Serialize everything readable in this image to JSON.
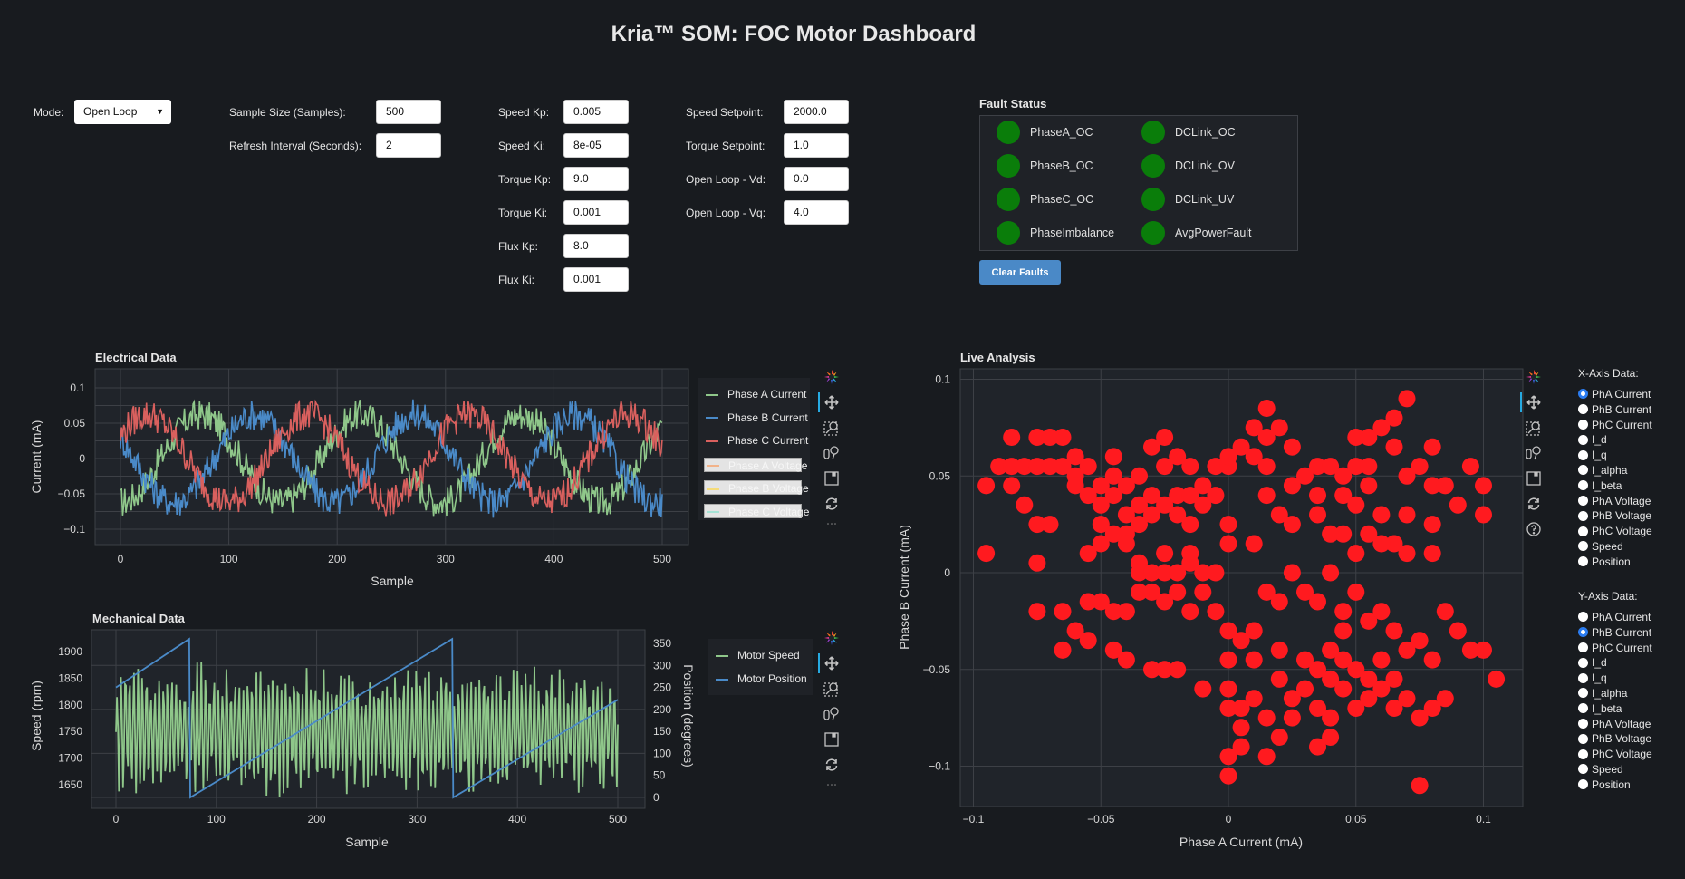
{
  "header": {
    "title": "Kria™ SOM: FOC Motor Dashboard"
  },
  "controls": {
    "mode": {
      "label": "Mode:",
      "value": "Open Loop"
    },
    "sample_size": {
      "label": "Sample Size (Samples):",
      "value": "500"
    },
    "refresh_interval": {
      "label": "Refresh Interval (Seconds):",
      "value": "2"
    },
    "gains": [
      {
        "label": "Speed Kp:",
        "value": "0.005"
      },
      {
        "label": "Speed Ki:",
        "value": "8e-05"
      },
      {
        "label": "Torque Kp:",
        "value": "9.0"
      },
      {
        "label": "Torque Ki:",
        "value": "0.001"
      },
      {
        "label": "Flux Kp:",
        "value": "8.0"
      },
      {
        "label": "Flux Ki:",
        "value": "0.001"
      }
    ],
    "setpoints": [
      {
        "label": "Speed Setpoint:",
        "value": "2000.0"
      },
      {
        "label": "Torque Setpoint:",
        "value": "1.0"
      },
      {
        "label": "Open Loop - Vd:",
        "value": "0.0"
      },
      {
        "label": "Open Loop - Vq:",
        "value": "4.0"
      }
    ]
  },
  "faults": {
    "title": "Fault Status",
    "ok_color": "#0a7d0a",
    "items": [
      {
        "name": "PhaseA_OC",
        "status": "ok"
      },
      {
        "name": "PhaseB_OC",
        "status": "ok"
      },
      {
        "name": "PhaseC_OC",
        "status": "ok"
      },
      {
        "name": "PhaseImbalance",
        "status": "ok"
      },
      {
        "name": "DCLink_OC",
        "status": "ok"
      },
      {
        "name": "DCLink_OV",
        "status": "ok"
      },
      {
        "name": "DCLink_UV",
        "status": "ok"
      },
      {
        "name": "AvgPowerFault",
        "status": "ok"
      }
    ],
    "clear_label": "Clear Faults"
  },
  "toolbar_icons": [
    "bokeh-logo-icon",
    "pan-icon",
    "box-zoom-icon",
    "wheel-zoom-icon",
    "save-icon",
    "reset-icon",
    "more-icon"
  ],
  "analysis_controls": {
    "x_title": "X-Axis Data:",
    "y_title": "Y-Axis Data:",
    "options": [
      "PhA Current",
      "PhB Current",
      "PhC Current",
      "I_d",
      "I_q",
      "I_alpha",
      "I_beta",
      "PhA Voltage",
      "PhB Voltage",
      "PhC Voltage",
      "Speed",
      "Position"
    ],
    "x_selected": "PhA Current",
    "y_selected": "PhB Current"
  },
  "chart_data": [
    {
      "id": "electrical",
      "type": "line",
      "title": "Electrical Data",
      "xlabel": "Sample",
      "ylabel": "Current (mA)",
      "xlim": [
        -22,
        528
      ],
      "ylim": [
        -0.12,
        0.125
      ],
      "xticks": [
        0,
        100,
        200,
        300,
        400,
        500
      ],
      "yticks": [
        0.1,
        0.05,
        0,
        -0.05,
        -0.1
      ],
      "ytick_labels": [
        "0.1",
        "0.05",
        "0",
        "−0.05",
        "−0.1"
      ],
      "grid": true,
      "legend": "right",
      "noise": 0.022,
      "series": [
        {
          "name": "Phase A Current",
          "color": "#8fc78a",
          "amplitude": 0.062,
          "period": 148,
          "phase_deg": -90,
          "visible": true
        },
        {
          "name": "Phase B Current",
          "color": "#4a8ac8",
          "amplitude": 0.062,
          "period": 148,
          "phase_deg": 150,
          "visible": true
        },
        {
          "name": "Phase C Current",
          "color": "#d9605e",
          "amplitude": 0.062,
          "period": 148,
          "phase_deg": 30,
          "visible": true
        },
        {
          "name": "Phase A Voltage",
          "color": "#f2b38a",
          "visible": false
        },
        {
          "name": "Phase B Voltage",
          "color": "#f5dc7a",
          "visible": false
        },
        {
          "name": "Phase C Voltage",
          "color": "#a6e3d6",
          "visible": false
        }
      ],
      "n_samples": 500
    },
    {
      "id": "mechanical",
      "type": "line",
      "title": "Mechanical Data",
      "xlabel": "Sample",
      "ylabel": "Speed (rpm)",
      "ylabel_right": "Position (degrees)",
      "xlim": [
        -25,
        530
      ],
      "ylim": [
        1620,
        1935
      ],
      "ylim_right": [
        -10,
        375
      ],
      "xticks": [
        0,
        100,
        200,
        300,
        400,
        500
      ],
      "yticks": [
        1650,
        1700,
        1750,
        1800,
        1850,
        1900
      ],
      "yticks_right": [
        0,
        50,
        100,
        150,
        200,
        250,
        300,
        350
      ],
      "grid": true,
      "legend": "right",
      "series": [
        {
          "name": "Motor Speed",
          "color": "#8fc78a",
          "axis": "left",
          "mean": 1750,
          "oscillation": 110,
          "period": 4.2
        },
        {
          "name": "Motor Position",
          "color": "#4a8ac8",
          "axis": "right",
          "segments": [
            [
              0,
              250
            ],
            [
              73,
              360
            ],
            [
              74,
              0
            ],
            [
              335,
              360
            ],
            [
              336,
              0
            ],
            [
              500,
              222
            ]
          ]
        }
      ],
      "n_samples": 500
    },
    {
      "id": "live-analysis",
      "type": "scatter",
      "title": "Live Analysis",
      "xlabel": "Phase A Current (mA)",
      "ylabel": "Phase B Current (mA)",
      "xlim": [
        -0.105,
        0.115
      ],
      "ylim": [
        -0.12,
        0.105
      ],
      "xticks": [
        -0.1,
        -0.05,
        0,
        0.05,
        0.1
      ],
      "xtick_labels": [
        "−0.1",
        "−0.05",
        "0",
        "0.05",
        "0.1"
      ],
      "yticks": [
        0.1,
        0.05,
        0,
        -0.05,
        -0.1
      ],
      "ytick_labels": [
        "0.1",
        "0.05",
        "0",
        "−0.05",
        "−0.1"
      ],
      "grid": true,
      "marker_color": "#ff1a1f",
      "points": [
        [
          -0.095,
          0.045
        ],
        [
          -0.09,
          0.055
        ],
        [
          -0.085,
          0.07
        ],
        [
          -0.085,
          0.055
        ],
        [
          -0.085,
          0.045
        ],
        [
          -0.08,
          0.055
        ],
        [
          -0.075,
          0.07
        ],
        [
          -0.075,
          0.055
        ],
        [
          -0.07,
          0.07
        ],
        [
          -0.07,
          0.055
        ],
        [
          -0.065,
          0.07
        ],
        [
          -0.065,
          0.055
        ],
        [
          -0.06,
          0.05
        ],
        [
          -0.06,
          0.06
        ],
        [
          -0.06,
          0.045
        ],
        [
          -0.055,
          0.04
        ],
        [
          -0.055,
          0.055
        ],
        [
          -0.05,
          0.045
        ],
        [
          -0.05,
          0.035
        ],
        [
          -0.05,
          0.025
        ],
        [
          -0.045,
          0.05
        ],
        [
          -0.045,
          0.06
        ],
        [
          -0.045,
          0.04
        ],
        [
          -0.04,
          0.045
        ],
        [
          -0.04,
          0.03
        ],
        [
          -0.04,
          0.02
        ],
        [
          -0.035,
          0.05
        ],
        [
          -0.035,
          0.035
        ],
        [
          -0.035,
          0.025
        ],
        [
          -0.03,
          0.04
        ],
        [
          -0.03,
          0.03
        ],
        [
          -0.03,
          0.065
        ],
        [
          -0.025,
          0.07
        ],
        [
          -0.025,
          0.055
        ],
        [
          -0.025,
          0.035
        ],
        [
          -0.02,
          0.04
        ],
        [
          -0.02,
          0.03
        ],
        [
          -0.02,
          0.06
        ],
        [
          -0.015,
          0.055
        ],
        [
          -0.015,
          0.04
        ],
        [
          -0.015,
          0.025
        ],
        [
          -0.01,
          0.045
        ],
        [
          -0.01,
          0.035
        ],
        [
          -0.005,
          0.055
        ],
        [
          -0.005,
          0.04
        ],
        [
          0,
          0.055
        ],
        [
          0,
          0.06
        ],
        [
          0.005,
          0.065
        ],
        [
          0.01,
          0.075
        ],
        [
          0.01,
          0.06
        ],
        [
          0.015,
          0.085
        ],
        [
          0.015,
          0.07
        ],
        [
          0.015,
          0.055
        ],
        [
          -0.08,
          0.035
        ],
        [
          -0.075,
          0.025
        ],
        [
          -0.07,
          0.025
        ],
        [
          -0.095,
          0.01
        ],
        [
          -0.075,
          0.005
        ],
        [
          -0.055,
          0.01
        ],
        [
          -0.05,
          0.015
        ],
        [
          -0.045,
          0.02
        ],
        [
          -0.04,
          0.015
        ],
        [
          -0.035,
          0.005
        ],
        [
          -0.035,
          0
        ],
        [
          -0.03,
          0
        ],
        [
          -0.025,
          0
        ],
        [
          -0.025,
          0.01
        ],
        [
          -0.02,
          0
        ],
        [
          -0.015,
          0.005
        ],
        [
          -0.015,
          0.01
        ],
        [
          -0.01,
          0
        ],
        [
          -0.005,
          0
        ],
        [
          0,
          0.015
        ],
        [
          -0.01,
          -0.01
        ],
        [
          -0.02,
          -0.01
        ],
        [
          -0.025,
          -0.015
        ],
        [
          -0.03,
          -0.01
        ],
        [
          -0.035,
          -0.01
        ],
        [
          -0.04,
          -0.02
        ],
        [
          -0.045,
          -0.02
        ],
        [
          -0.05,
          -0.015
        ],
        [
          -0.055,
          -0.015
        ],
        [
          -0.06,
          -0.03
        ],
        [
          -0.065,
          -0.04
        ],
        [
          -0.055,
          -0.035
        ],
        [
          -0.045,
          -0.04
        ],
        [
          -0.04,
          -0.045
        ],
        [
          -0.03,
          -0.05
        ],
        [
          -0.025,
          -0.05
        ],
        [
          -0.02,
          -0.05
        ],
        [
          -0.015,
          -0.02
        ],
        [
          -0.075,
          -0.02
        ],
        [
          -0.065,
          -0.02
        ],
        [
          0.025,
          0.045
        ],
        [
          0.02,
          0.03
        ],
        [
          0.015,
          0.04
        ],
        [
          0.01,
          0.015
        ],
        [
          0,
          0.025
        ],
        [
          0.025,
          0.025
        ],
        [
          0.035,
          0.055
        ],
        [
          0.04,
          0.055
        ],
        [
          0.045,
          0.05
        ],
        [
          0.045,
          0.04
        ],
        [
          0.05,
          0.055
        ],
        [
          0.05,
          0.07
        ],
        [
          0.055,
          0.07
        ],
        [
          0.055,
          0.055
        ],
        [
          0.06,
          0.075
        ],
        [
          0.065,
          0.08
        ],
        [
          0.065,
          0.065
        ],
        [
          0.07,
          0.09
        ],
        [
          0.07,
          0.05
        ],
        [
          0.075,
          0.055
        ],
        [
          0.08,
          0.065
        ],
        [
          0.08,
          0.045
        ],
        [
          0.085,
          0.045
        ],
        [
          0.09,
          0.035
        ],
        [
          0.095,
          0.055
        ],
        [
          0.1,
          0.045
        ],
        [
          0.1,
          0.03
        ],
        [
          0.08,
          0.025
        ],
        [
          0.08,
          0.01
        ],
        [
          0.07,
          0.03
        ],
        [
          0.07,
          0.01
        ],
        [
          0.065,
          0.015
        ],
        [
          0.06,
          0.03
        ],
        [
          0.06,
          0.015
        ],
        [
          0.055,
          0.02
        ],
        [
          0.05,
          0.035
        ],
        [
          0.055,
          0.045
        ],
        [
          0.05,
          0.01
        ],
        [
          0.045,
          0.02
        ],
        [
          0.04,
          0.02
        ],
        [
          0.035,
          0.04
        ],
        [
          0.035,
          0.03
        ],
        [
          0.03,
          0.05
        ],
        [
          0.025,
          0.065
        ],
        [
          0.02,
          0.075
        ],
        [
          0.015,
          -0.01
        ],
        [
          0.02,
          -0.015
        ],
        [
          0.025,
          0
        ],
        [
          0.03,
          -0.01
        ],
        [
          0.035,
          -0.015
        ],
        [
          0.04,
          0
        ],
        [
          0.045,
          -0.02
        ],
        [
          0.05,
          -0.01
        ],
        [
          0.055,
          -0.025
        ],
        [
          0.06,
          -0.02
        ],
        [
          0.065,
          -0.03
        ],
        [
          0.07,
          -0.04
        ],
        [
          0.075,
          -0.035
        ],
        [
          0.08,
          -0.045
        ],
        [
          0.085,
          -0.02
        ],
        [
          0.09,
          -0.03
        ],
        [
          0.095,
          -0.04
        ],
        [
          0.1,
          -0.04
        ],
        [
          0.105,
          -0.055
        ],
        [
          0.085,
          -0.065
        ],
        [
          0.08,
          -0.07
        ],
        [
          0.075,
          -0.075
        ],
        [
          0.07,
          -0.065
        ],
        [
          0.065,
          -0.07
        ],
        [
          0.06,
          -0.06
        ],
        [
          0.055,
          -0.065
        ],
        [
          0.05,
          -0.07
        ],
        [
          0.045,
          -0.06
        ],
        [
          0.04,
          -0.075
        ],
        [
          0.035,
          -0.07
        ],
        [
          0.03,
          -0.06
        ],
        [
          0.025,
          -0.065
        ],
        [
          0.02,
          -0.055
        ],
        [
          0.015,
          -0.075
        ],
        [
          0.01,
          -0.065
        ],
        [
          0.005,
          -0.07
        ],
        [
          0,
          -0.07
        ],
        [
          0,
          -0.06
        ],
        [
          0,
          -0.045
        ],
        [
          0.005,
          -0.08
        ],
        [
          0.005,
          -0.09
        ],
        [
          0,
          -0.095
        ],
        [
          0,
          -0.105
        ],
        [
          0.015,
          -0.095
        ],
        [
          0.02,
          -0.085
        ],
        [
          0.035,
          -0.09
        ],
        [
          0.04,
          -0.085
        ],
        [
          0.075,
          -0.11
        ],
        [
          -0.01,
          -0.06
        ],
        [
          0.01,
          -0.03
        ],
        [
          0.01,
          -0.045
        ],
        [
          0.05,
          -0.05
        ],
        [
          0.055,
          -0.055
        ],
        [
          0.045,
          -0.045
        ],
        [
          0.06,
          -0.045
        ],
        [
          0.065,
          -0.055
        ],
        [
          0.03,
          -0.045
        ],
        [
          0.035,
          -0.05
        ],
        [
          0.04,
          -0.055
        ],
        [
          0.025,
          -0.075
        ],
        [
          0.02,
          -0.04
        ],
        [
          0.045,
          -0.03
        ],
        [
          0.04,
          -0.04
        ],
        [
          0.0,
          -0.03
        ],
        [
          0.005,
          -0.035
        ],
        [
          -0.005,
          -0.02
        ]
      ]
    }
  ]
}
